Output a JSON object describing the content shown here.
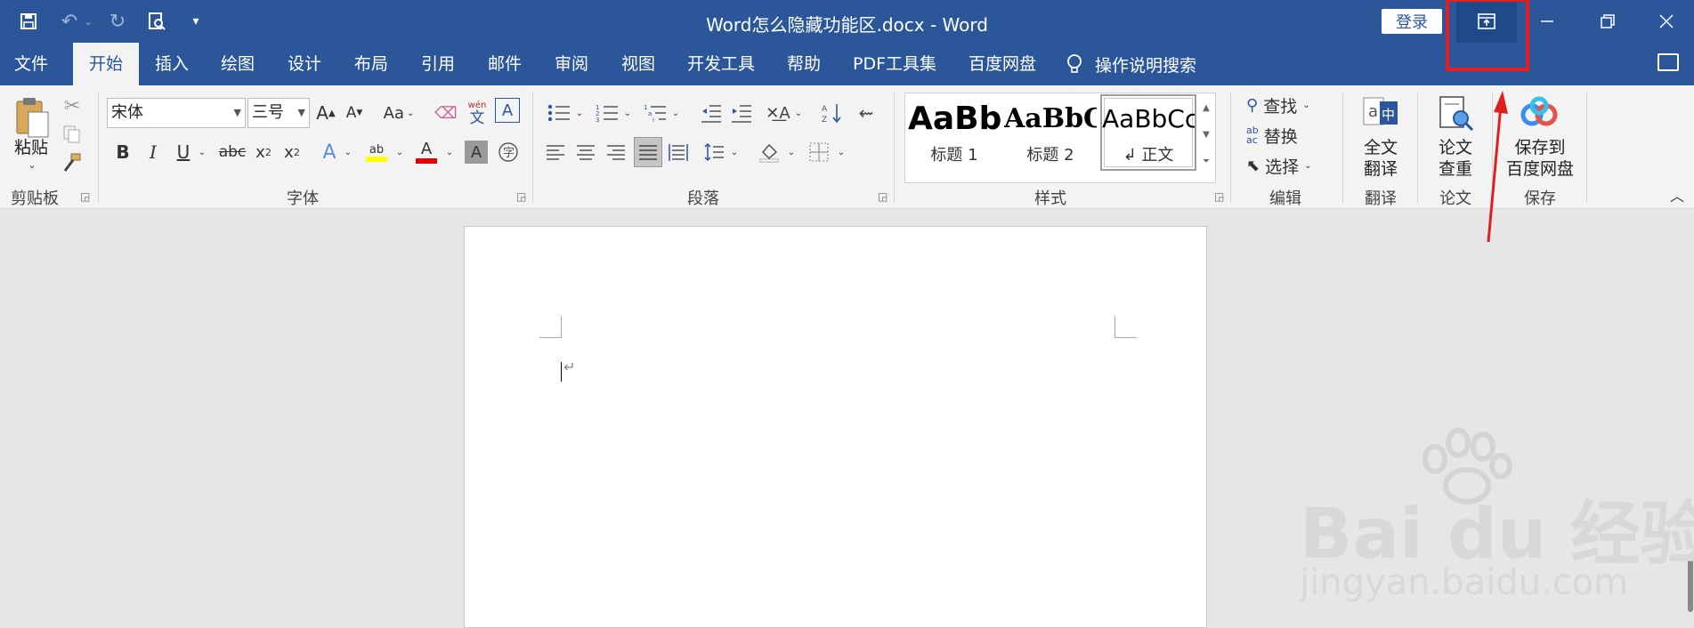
{
  "window": {
    "title": "Word怎么隐藏功能区.docx  -  Word",
    "login_label": "登录"
  },
  "tabs": [
    "文件",
    "开始",
    "插入",
    "绘图",
    "设计",
    "布局",
    "引用",
    "邮件",
    "审阅",
    "视图",
    "开发工具",
    "帮助",
    "PDF工具集",
    "百度网盘"
  ],
  "tell_me": "操作说明搜索",
  "ribbon": {
    "clipboard": {
      "paste_label": "粘贴",
      "group_label": "剪贴板"
    },
    "font": {
      "name_value": "宋体",
      "size_value": "三号",
      "change_case": "Aa",
      "group_label": "字体"
    },
    "paragraph": {
      "group_label": "段落"
    },
    "styles": {
      "group_label": "样式",
      "items": [
        {
          "sample": "AaBb",
          "name": "标题 1"
        },
        {
          "sample": "AaBbC",
          "name": "标题 2"
        },
        {
          "sample": "AaBbCc",
          "name": "↲ 正文"
        }
      ]
    },
    "editing": {
      "find": "查找",
      "replace": "替换",
      "select": "选择",
      "group_label": "编辑"
    },
    "translate": {
      "line1": "全文",
      "line2": "翻译",
      "group_label": "翻译"
    },
    "paper": {
      "line1": "论文",
      "line2": "查重",
      "group_label": "论文"
    },
    "save": {
      "line1": "保存到",
      "line2": "百度网盘",
      "group_label": "保存"
    }
  },
  "watermark": {
    "brand": "Bai du 经验",
    "url": "jingyan.baidu.com"
  },
  "colors": {
    "accent": "#2b579a",
    "highlight_box": "#e02020"
  }
}
